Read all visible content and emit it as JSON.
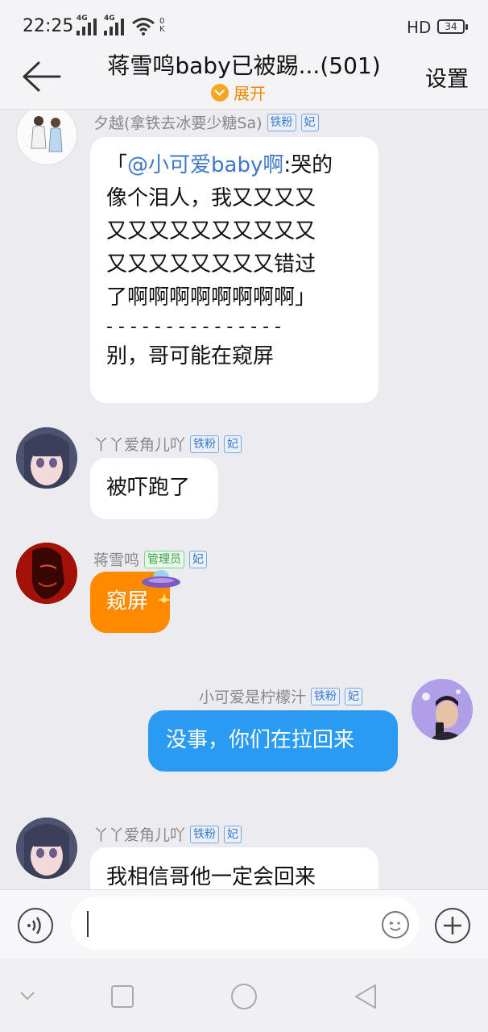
{
  "status_bar": {
    "time": "22:25",
    "network1": "4G",
    "network2": "4G",
    "ok_label": "0 K",
    "hd_label": "HD",
    "battery": "34"
  },
  "header": {
    "title": "蒋雪鸣baby已被踢...(501)",
    "expand_label": "展开",
    "settings_label": "设置"
  },
  "badges": {
    "tiefen": "铁粉",
    "fei": "妃",
    "admin": "管理员"
  },
  "messages": [
    {
      "sender": "夕越(拿铁去冰要少糖Sa)",
      "mention": "@小可爱baby啊",
      "lines": [
        ":哭的",
        "像个泪人，我又又又又",
        "又又又又又又又又又又",
        "又又又又又又又又错过",
        "了啊啊啊啊啊啊啊啊」",
        "- - - - - - - - - - - - - - -",
        "别，哥可能在窥屏"
      ],
      "quote_open": "「"
    },
    {
      "sender": "丫丫爱角儿吖",
      "text": "被吓跑了"
    },
    {
      "sender": "蒋雪鸣",
      "text": "窥屏"
    },
    {
      "sender": "小可爱是柠檬汁",
      "text": "没事，你们在拉回来"
    },
    {
      "sender": "丫丫爱角儿吖",
      "text": "我相信哥他一定会回来"
    }
  ],
  "input": {
    "placeholder": ""
  },
  "colors": {
    "accent_orange": "#ff8a00",
    "self_bubble": "#2a9af2",
    "background": "#ececf0"
  },
  "icons": [
    "back-arrow-icon",
    "chevron-down-icon",
    "voice-icon",
    "emoji-icon",
    "plus-icon",
    "nav-back-icon",
    "nav-home-icon",
    "nav-recents-icon",
    "nav-collapse-icon"
  ]
}
